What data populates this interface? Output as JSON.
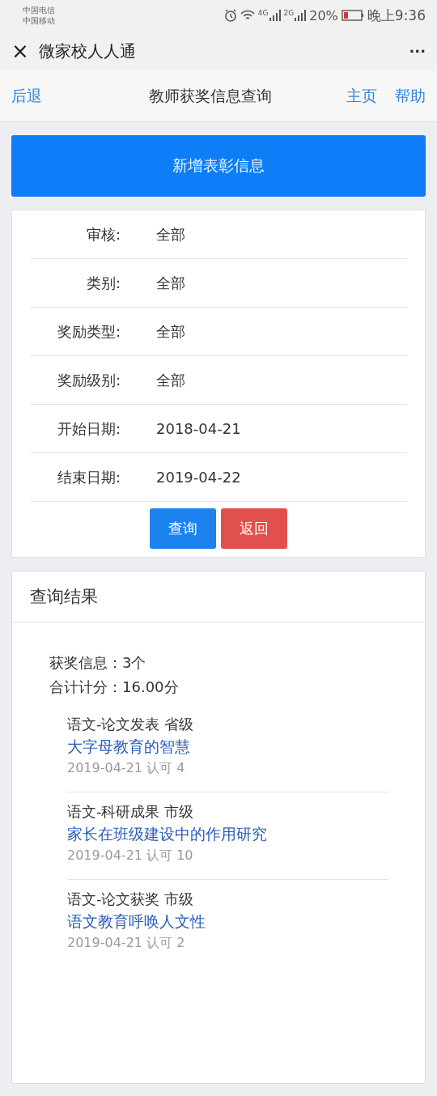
{
  "status_bar": {
    "carriers": [
      "中国电信",
      "中国移动"
    ],
    "signals": [
      {
        "label": "4G"
      },
      {
        "label": "2G"
      }
    ],
    "battery": "20%",
    "time": "晚上9:36"
  },
  "app_header": {
    "close": "×",
    "title": "微家校人人通",
    "more": "···"
  },
  "nav": {
    "back": "后退",
    "title": "教师获奖信息查询",
    "links": [
      "主页",
      "帮助"
    ]
  },
  "add_button": "新增表彰信息",
  "filters": [
    {
      "label": "审核:",
      "value": "全部"
    },
    {
      "label": "类别:",
      "value": "全部"
    },
    {
      "label": "奖励类型:",
      "value": "全部"
    },
    {
      "label": "奖励级别:",
      "value": "全部"
    },
    {
      "label": "开始日期:",
      "value": "2018-04-21"
    },
    {
      "label": "结束日期:",
      "value": "2019-04-22"
    }
  ],
  "filter_buttons": [
    {
      "label": "查询",
      "kind": "primary"
    },
    {
      "label": "返回",
      "kind": "danger"
    }
  ],
  "results": {
    "title": "查询结果",
    "summary": [
      "获奖信息：3个",
      "合计计分：16.00分"
    ],
    "items": [
      {
        "category": "语文-论文发表 省级",
        "title": "大字母教育的智慧",
        "meta": "2019-04-21 认可 4"
      },
      {
        "category": "语文-科研成果 市级",
        "title": "家长在班级建设中的作用研究",
        "meta": "2019-04-21 认可 10"
      },
      {
        "category": "语文-论文获奖 市级",
        "title": "语文教育呼唤人文性",
        "meta": "2019-04-21 认可 2"
      }
    ]
  }
}
